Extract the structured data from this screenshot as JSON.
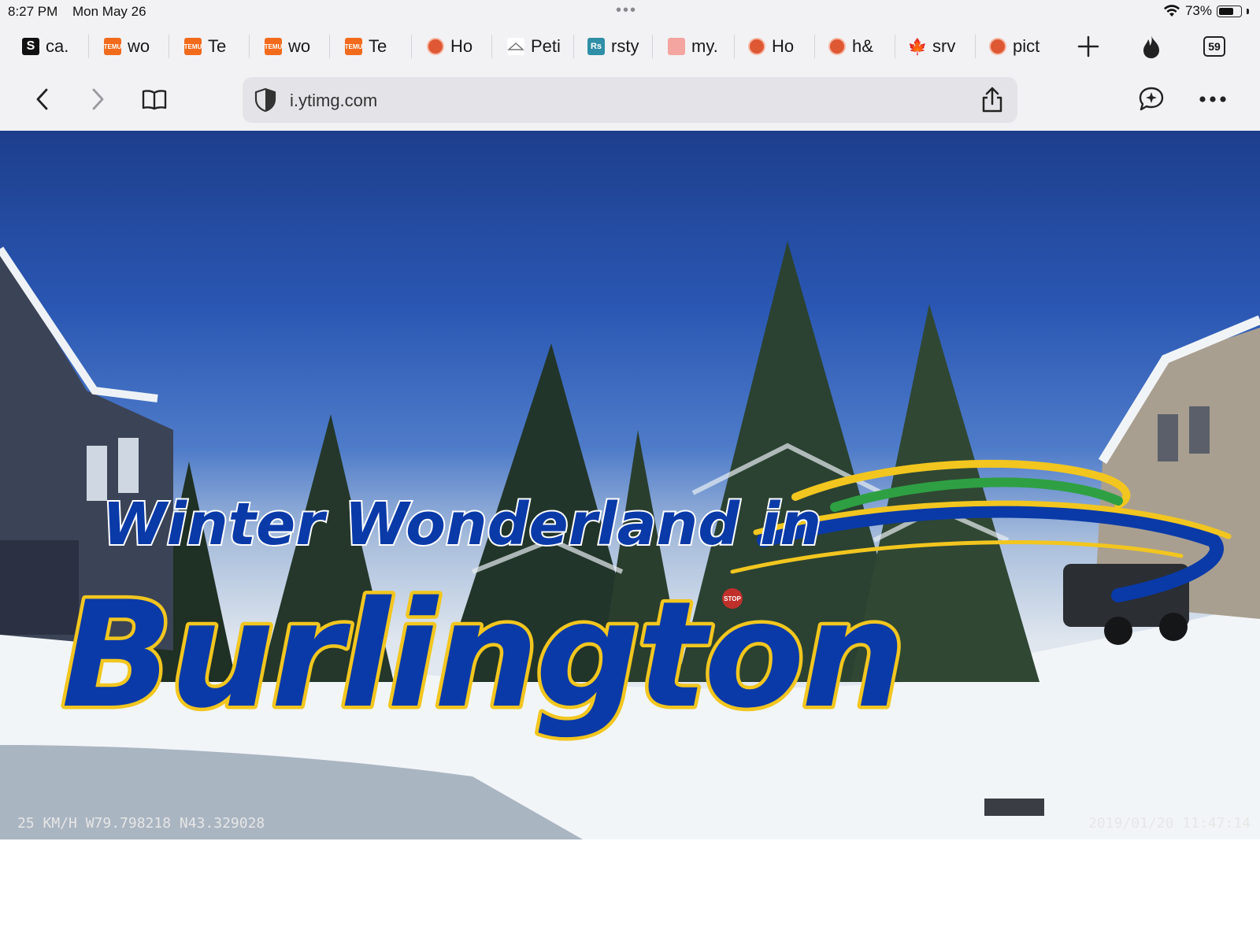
{
  "status": {
    "time": "8:27 PM",
    "date": "Mon May 26",
    "battery": "73%",
    "battery_level": 0.73
  },
  "tabs": [
    {
      "favicon": "s-icon",
      "label": "ca."
    },
    {
      "favicon": "temu-icon",
      "label": "wo"
    },
    {
      "favicon": "temu-icon",
      "label": "Te"
    },
    {
      "favicon": "temu-icon",
      "label": "wo"
    },
    {
      "favicon": "temu-icon",
      "label": "Te"
    },
    {
      "favicon": "duckduckgo-icon",
      "label": "Ho"
    },
    {
      "favicon": "hanger-icon",
      "label": "Peti"
    },
    {
      "favicon": "rs-icon",
      "label": "rsty"
    },
    {
      "favicon": "pink-icon",
      "label": "my."
    },
    {
      "favicon": "duckduckgo-icon",
      "label": "Ho"
    },
    {
      "favicon": "duckduckgo-icon",
      "label": "h&"
    },
    {
      "favicon": "maple-leaf-icon",
      "label": "srv"
    },
    {
      "favicon": "duckduckgo-icon",
      "label": "pict"
    }
  ],
  "tab_count": "59",
  "address": {
    "url": "i.ytimg.com"
  },
  "image": {
    "title_line1": "Winter Wonderland in",
    "title_line2": "Burlington",
    "dashcam_left": "25 KM/H W79.798218 N43.329028",
    "dashcam_right": "2019/01/20 11:47:14",
    "stop_sign": "STOP",
    "colors": {
      "title_fill": "#0a3aa8",
      "title_outline": "#f2c61f",
      "swoosh_green": "#2ea043"
    }
  }
}
